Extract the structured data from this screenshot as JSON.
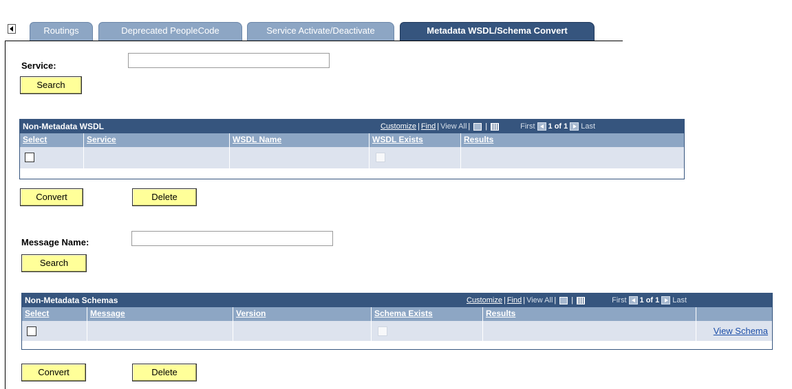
{
  "tabs": {
    "items": [
      {
        "label": "Routings"
      },
      {
        "label": "Deprecated PeopleCode"
      },
      {
        "label": "Service Activate/Deactivate"
      },
      {
        "label": "Metadata WSDL/Schema Convert"
      }
    ]
  },
  "service_form": {
    "label": "Service:",
    "value": "",
    "search_label": "Search"
  },
  "wsdl_grid": {
    "title": "Non-Metadata WSDL",
    "customize": "Customize",
    "find": "Find",
    "view_all": "View All",
    "first": "First",
    "page_info": "1 of 1",
    "last": "Last",
    "columns": [
      "Select",
      "Service",
      "WSDL Name",
      "WSDL Exists",
      "Results"
    ]
  },
  "wsdl_actions": {
    "convert": "Convert",
    "delete": "Delete"
  },
  "message_form": {
    "label": "Message Name:",
    "value": "",
    "search_label": "Search"
  },
  "schema_grid": {
    "title": "Non-Metadata Schemas",
    "customize": "Customize",
    "find": "Find",
    "view_all": "View All",
    "first": "First",
    "page_info": "1 of 1",
    "last": "Last",
    "columns": [
      "Select",
      "Message",
      "Version",
      "Schema Exists",
      "Results"
    ],
    "row_link": "View Schema"
  },
  "schema_actions": {
    "convert": "Convert",
    "delete": "Delete"
  }
}
